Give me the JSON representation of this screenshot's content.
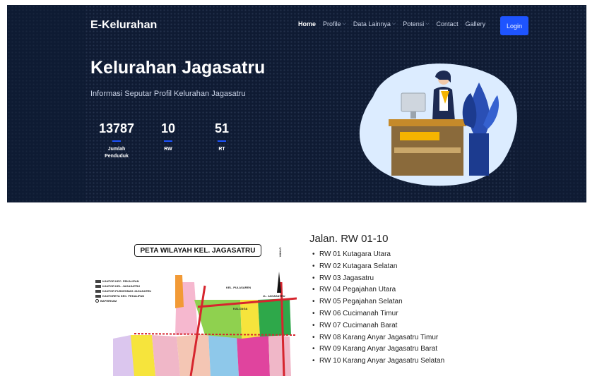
{
  "header": {
    "brand": "E-Kelurahan",
    "nav": [
      {
        "label": "Home",
        "dropdown": false,
        "active": true
      },
      {
        "label": "Profile",
        "dropdown": true
      },
      {
        "label": "Data Lainnya",
        "dropdown": true
      },
      {
        "label": "Potensi",
        "dropdown": true
      },
      {
        "label": "Contact",
        "dropdown": false
      },
      {
        "label": "Gallery",
        "dropdown": false
      }
    ],
    "login_label": "Login"
  },
  "hero": {
    "title": "Kelurahan Jagasatru",
    "subtitle": "Informasi Seputar Profil Kelurahan Jagasatru",
    "stats": [
      {
        "value": "13787",
        "label": "Jumlah Penduduk"
      },
      {
        "value": "10",
        "label": "RW"
      },
      {
        "value": "51",
        "label": "RT"
      }
    ]
  },
  "map": {
    "title": "PETA WILAYAH KEL. JAGASATRU",
    "legend": [
      "KANTOR KEC. PEKALIPAN",
      "KANTOR KEL. JAGASATRU",
      "KANTOR PUSKESMAS JAGASATRU",
      "KANTORETA KEC. PEKALIPAN",
      "BAPERKAM"
    ],
    "labels": [
      "KEL. PULASAREN",
      "JL. JAGASATRU",
      "KALIJAGA",
      "JL. KESAMBI DALAM",
      "UTARA"
    ]
  },
  "rw_section": {
    "title": "Jalan. RW 01-10",
    "items": [
      "RW 01 Kutagara Utara",
      "RW 02 Kutagara Selatan",
      "RW 03 Jagasatru",
      "RW 04 Pegajahan Utara",
      "RW 05 Pegajahan Selatan",
      "RW 06 Cucimanah Timur",
      "RW 07 Cucimanah Barat",
      "RW 08 Karang Anyar Jagasatru Timur",
      "RW 09 Karang Anyar Jagasatru Barat",
      "RW 10 Karang Anyar Jagasatru Selatan"
    ]
  },
  "colors": {
    "hero_bg": "#0f1b33",
    "accent": "#1e54ff"
  }
}
